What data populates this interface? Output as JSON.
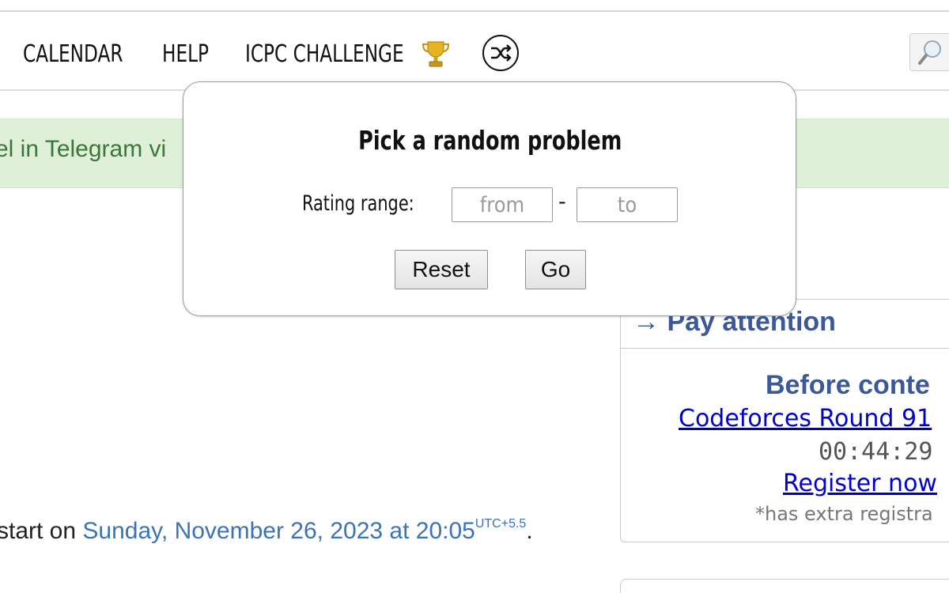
{
  "header": {
    "menu": [
      {
        "label": "CALENDAR"
      },
      {
        "label": "HELP"
      },
      {
        "label": "ICPC CHALLENGE"
      }
    ],
    "icons": {
      "trophy": "trophy-icon",
      "shuffle": "shuffle-icon",
      "search": "search-icon"
    }
  },
  "notice": {
    "text": "el in Telegram vi"
  },
  "contest_info": {
    "prefix": "start on ",
    "date_text": "Sunday, November 26, 2023 at 20:05",
    "timezone": "UTC+5.5",
    "suffix": "."
  },
  "sidebar": {
    "title": "→ Pay attention",
    "before_contest": "Before conte",
    "round_link": "Codeforces Round 91",
    "countdown": "00:44:29",
    "register_link": "Register now",
    "note": "*has extra registra"
  },
  "popup": {
    "title": "Pick a random problem",
    "rating_label": "Rating range:",
    "from_placeholder": "from",
    "from_value": "",
    "dash": "-",
    "to_placeholder": "to",
    "to_value": "",
    "reset_label": "Reset",
    "go_label": "Go"
  },
  "colors": {
    "notice_bg": "#dff0d8",
    "notice_text": "#3c763d",
    "link_blue": "#0000cc",
    "date_blue": "#3b73b9",
    "sidebar_title": "#3b5998"
  }
}
